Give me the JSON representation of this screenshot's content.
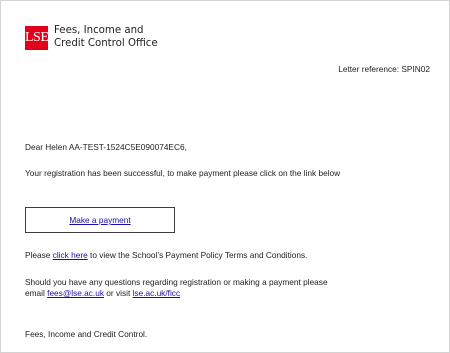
{
  "header": {
    "logo_text": "LSE",
    "office_line1": "Fees, Income and",
    "office_line2": "Credit Control Office"
  },
  "letter": {
    "reference": "Letter reference: SPIN02",
    "greeting": "Dear Helen AA-TEST-1524C5E090074EC6,",
    "success_text": "Your registration has been successful, to make payment please click on the link below",
    "payment_link": "Make a payment",
    "policy_prefix": "Please ",
    "policy_link": "click here",
    "policy_suffix": " to view the School’s Payment Policy Terms and Conditions.",
    "questions_text": "Should you have any questions regarding registration or making a payment please email ",
    "email_link": "fees@lse.ac.uk",
    "or_visit": " or visit ",
    "site_link": "lse.ac.uk/ficc",
    "signoff": "Fees, Income and Credit Control."
  },
  "colors": {
    "brand_red": "#e3001b",
    "link": "#1a0dab"
  }
}
